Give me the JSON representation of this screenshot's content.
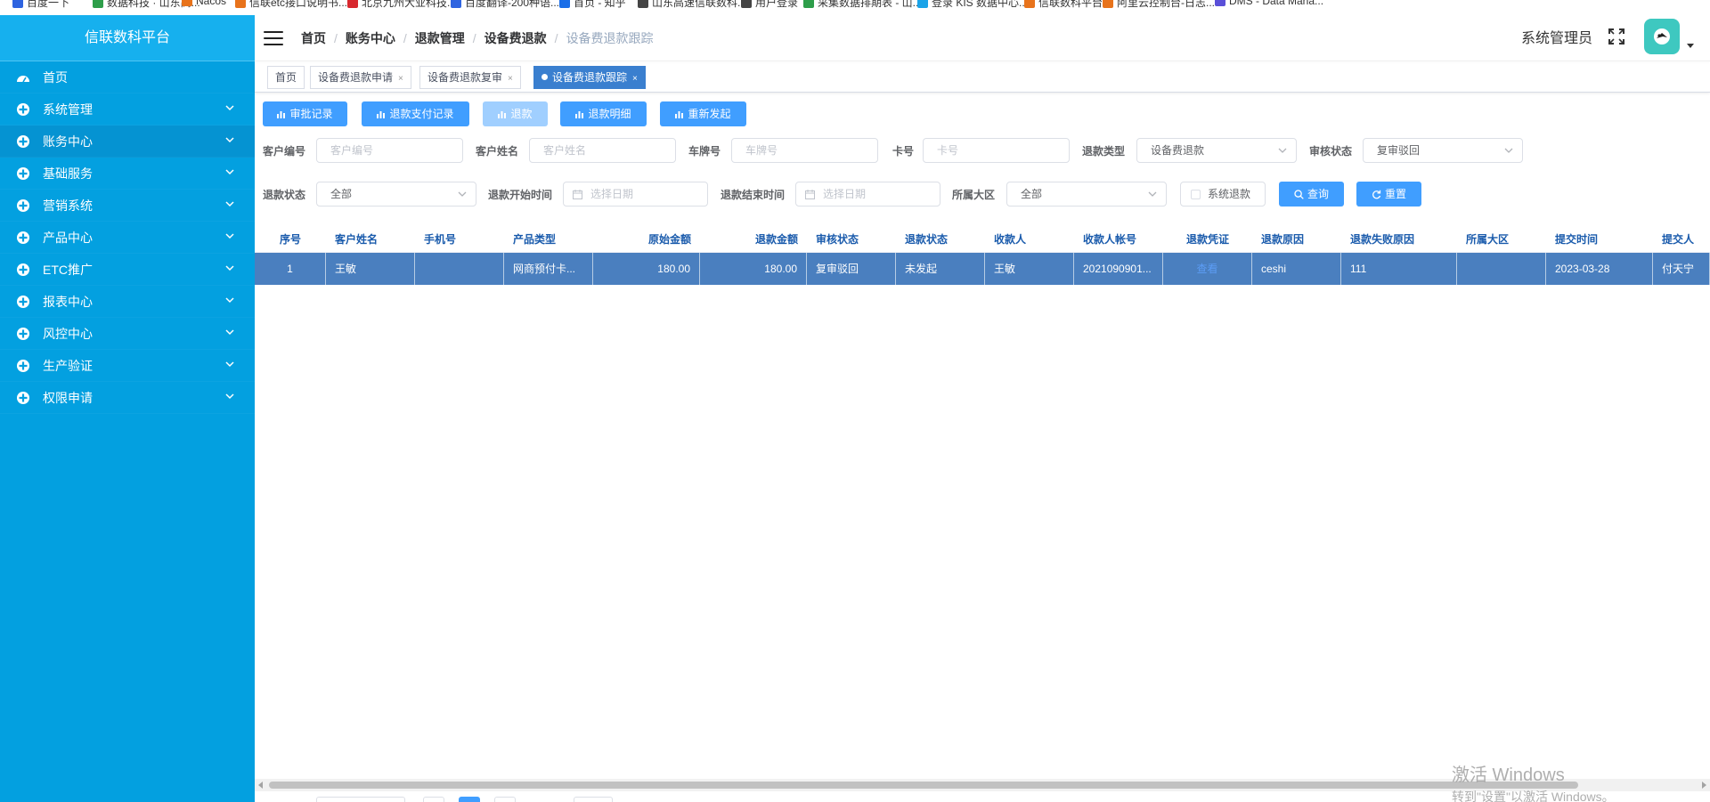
{
  "bookmarks": [
    {
      "label": "百度一下",
      "color": "#2f64e0"
    },
    {
      "label": "数据科技 · 山东高...",
      "color": "#2e9e4a"
    },
    {
      "label": "Nacos",
      "color": "#e8731b"
    },
    {
      "label": "信联etc接口说明书...",
      "color": "#e8731b"
    },
    {
      "label": "北京九州大业科技...",
      "color": "#d8282e"
    },
    {
      "label": "百度翻译-200种语...",
      "color": "#2f64e0"
    },
    {
      "label": "首页 - 知乎",
      "color": "#1a6ee8"
    },
    {
      "label": "山东高速信联数科...",
      "color": "#444444"
    },
    {
      "label": "用户登录",
      "color": "#444444"
    },
    {
      "label": "采集数据排期表 - 山...",
      "color": "#2e9e4a"
    },
    {
      "label": "登录 KIS 数据中心...",
      "color": "#1aa3e8"
    },
    {
      "label": "信联数科平台",
      "color": "#e8731b"
    },
    {
      "label": "阿里云控制台-日志...",
      "color": "#e8731b"
    },
    {
      "label": "DMS - Data Mana...",
      "color": "#5a4fd8"
    }
  ],
  "sidebar": {
    "title": "信联数科平台",
    "items": [
      {
        "label": "首页",
        "icon": "dashboard-icon",
        "expandable": false
      },
      {
        "label": "系统管理",
        "icon": "menu-circle-icon",
        "expandable": true
      },
      {
        "label": "账务中心",
        "icon": "menu-circle-icon",
        "expandable": true
      },
      {
        "label": "基础服务",
        "icon": "menu-circle-icon",
        "expandable": true
      },
      {
        "label": "营销系统",
        "icon": "menu-circle-icon",
        "expandable": true
      },
      {
        "label": "产品中心",
        "icon": "menu-circle-icon",
        "expandable": true
      },
      {
        "label": "ETC推广",
        "icon": "menu-circle-icon",
        "expandable": true
      },
      {
        "label": "报表中心",
        "icon": "menu-circle-icon",
        "expandable": true
      },
      {
        "label": "风控中心",
        "icon": "menu-circle-icon",
        "expandable": true
      },
      {
        "label": "生产验证",
        "icon": "menu-circle-icon",
        "expandable": true
      },
      {
        "label": "权限申请",
        "icon": "menu-circle-icon",
        "expandable": true
      }
    ]
  },
  "header": {
    "breadcrumb": [
      "首页",
      "账务中心",
      "退款管理",
      "设备费退款",
      "设备费退款跟踪"
    ],
    "breadcrumb_sep": "/",
    "user_name": "系统管理员"
  },
  "tags": [
    {
      "label": "首页",
      "closable": false,
      "active": false
    },
    {
      "label": "设备费退款申请",
      "closable": true,
      "active": false
    },
    {
      "label": "设备费退款复审",
      "closable": true,
      "active": false
    },
    {
      "label": "设备费退款跟踪",
      "closable": true,
      "active": true
    }
  ],
  "tag_close": "×",
  "toolbar": {
    "buttons": [
      {
        "label": "审批记录",
        "disabled": false
      },
      {
        "label": "退款支付记录",
        "disabled": false
      },
      {
        "label": "退款",
        "disabled": true
      },
      {
        "label": "退款明细",
        "disabled": false
      },
      {
        "label": "重新发起",
        "disabled": false
      }
    ]
  },
  "filters": {
    "customer_no": {
      "label": "客户编号",
      "placeholder": "客户编号",
      "value": ""
    },
    "customer_name": {
      "label": "客户姓名",
      "placeholder": "客户姓名",
      "value": ""
    },
    "plate_no": {
      "label": "车牌号",
      "placeholder": "车牌号",
      "value": ""
    },
    "card_no": {
      "label": "卡号",
      "placeholder": "卡号",
      "value": ""
    },
    "refund_type": {
      "label": "退款类型",
      "value": "设备费退款"
    },
    "audit_status": {
      "label": "审核状态",
      "value": "复审驳回"
    },
    "refund_status": {
      "label": "退款状态",
      "value": "全部"
    },
    "start_time": {
      "label": "退款开始时间",
      "placeholder": "选择日期"
    },
    "end_time": {
      "label": "退款结束时间",
      "placeholder": "选择日期"
    },
    "region": {
      "label": "所属大区",
      "value": "全部"
    },
    "system_refund": {
      "label": "系统退款",
      "checked": false
    },
    "search_label": "查询",
    "reset_label": "重置"
  },
  "table": {
    "columns": [
      "序号",
      "客户姓名",
      "手机号",
      "产品类型",
      "原始金额",
      "退款金额",
      "审核状态",
      "退款状态",
      "收款人",
      "收款人帐号",
      "退款凭证",
      "退款原因",
      "退款失败原因",
      "所属大区",
      "提交时间",
      "提交人"
    ],
    "rows": [
      {
        "cells": [
          "1",
          "王敏",
          "",
          "网商预付卡...",
          "180.00",
          "180.00",
          "复审驳回",
          "未发起",
          "王敏",
          "2021090901...",
          "查看",
          "ceshi",
          "111",
          "",
          "2023-03-28",
          "付天宁"
        ]
      }
    ],
    "selected_row_color": "#4a7fbf",
    "header_text_color": "#1a5bac"
  },
  "watermark": {
    "line1": "激活 Windows",
    "line2": "转到\"设置\"以激活 Windows。"
  },
  "colors": {
    "sidebar_bg": "#03a0e0",
    "primary": "#409eff",
    "active_tag": "#3a7fcf",
    "avatar_bg": "#3ec8c0"
  }
}
